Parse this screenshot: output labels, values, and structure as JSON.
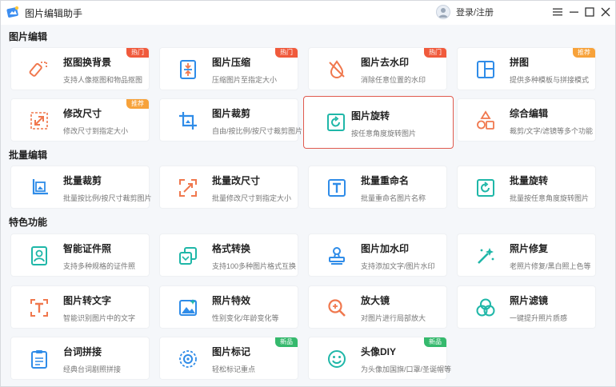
{
  "app": {
    "title": "图片编辑助手",
    "login": "登录/注册"
  },
  "colors": {
    "icon_orange": "#f0784e",
    "icon_blue": "#2f8ce8",
    "icon_teal": "#1fb7a8",
    "badge_hot": "#f05a3c",
    "badge_rec": "#f7a23a",
    "badge_new": "#35b96d",
    "selected_border": "#e05a4e"
  },
  "sections": [
    {
      "title": "图片编辑"
    },
    {
      "title": "批量编辑"
    },
    {
      "title": "特色功能"
    }
  ],
  "cards": {
    "cutout": {
      "title": "抠图换背景",
      "desc": "支持人像抠图和物品抠图",
      "badge": "热门",
      "icon": "cutout-icon"
    },
    "compress": {
      "title": "图片压缩",
      "desc": "压缩图片至指定大小",
      "badge": "热门",
      "icon": "compress-icon"
    },
    "watermark_remove": {
      "title": "图片去水印",
      "desc": "消除任意位置的水印",
      "badge": "热门",
      "icon": "watermark-remove-icon"
    },
    "collage": {
      "title": "拼图",
      "desc": "提供多种模板与拼接模式",
      "badge": "推荐",
      "icon": "collage-icon"
    },
    "resize": {
      "title": "修改尺寸",
      "desc": "修改尺寸到指定大小",
      "badge": "推荐",
      "icon": "resize-icon"
    },
    "crop": {
      "title": "图片裁剪",
      "desc": "自由/按比例/按尺寸裁剪图片",
      "icon": "crop-icon"
    },
    "rotate": {
      "title": "图片旋转",
      "desc": "按任意角度旋转图片",
      "icon": "rotate-icon"
    },
    "combo_edit": {
      "title": "综合编辑",
      "desc": "裁剪/文字/滤镜等多个功能",
      "icon": "shapes-icon"
    },
    "batch_crop": {
      "title": "批量裁剪",
      "desc": "批量按比例/按尺寸裁剪图片",
      "icon": "batch-crop-icon"
    },
    "batch_resize": {
      "title": "批量改尺寸",
      "desc": "批量修改尺寸到指定大小",
      "icon": "batch-resize-icon"
    },
    "batch_rename": {
      "title": "批量重命名",
      "desc": "批量重命名图片名称",
      "icon": "rename-icon"
    },
    "batch_rotate": {
      "title": "批量旋转",
      "desc": "批量按任意角度旋转图片",
      "icon": "batch-rotate-icon"
    },
    "id_photo": {
      "title": "智能证件照",
      "desc": "支持多种规格的证件照",
      "icon": "id-photo-icon"
    },
    "format": {
      "title": "格式转换",
      "desc": "支持100多种图片格式互换",
      "icon": "format-convert-icon"
    },
    "add_watermark": {
      "title": "图片加水印",
      "desc": "支持添加文字/图片水印",
      "icon": "stamp-icon"
    },
    "restore": {
      "title": "照片修复",
      "desc": "老照片修复/黑白照上色等",
      "icon": "magic-wand-icon"
    },
    "ocr": {
      "title": "图片转文字",
      "desc": "智能识别图片中的文字",
      "icon": "ocr-icon"
    },
    "effects": {
      "title": "照片特效",
      "desc": "性别变化/年龄变化等",
      "icon": "effects-icon"
    },
    "magnifier": {
      "title": "放大镜",
      "desc": "对图片进行局部放大",
      "icon": "magnifier-icon"
    },
    "filter": {
      "title": "照片滤镜",
      "desc": "一键提升照片质感",
      "icon": "filter-icon"
    },
    "lines_stitch": {
      "title": "台词拼接",
      "desc": "经典台词剧照拼接",
      "icon": "clipboard-icon"
    },
    "annotate": {
      "title": "图片标记",
      "desc": "轻松标记重点",
      "badge": "新品",
      "icon": "mark-icon"
    },
    "avatar_diy": {
      "title": "头像DIY",
      "desc": "为头像加国旗/口罩/圣诞帽等",
      "badge": "新品",
      "icon": "smile-icon"
    }
  }
}
